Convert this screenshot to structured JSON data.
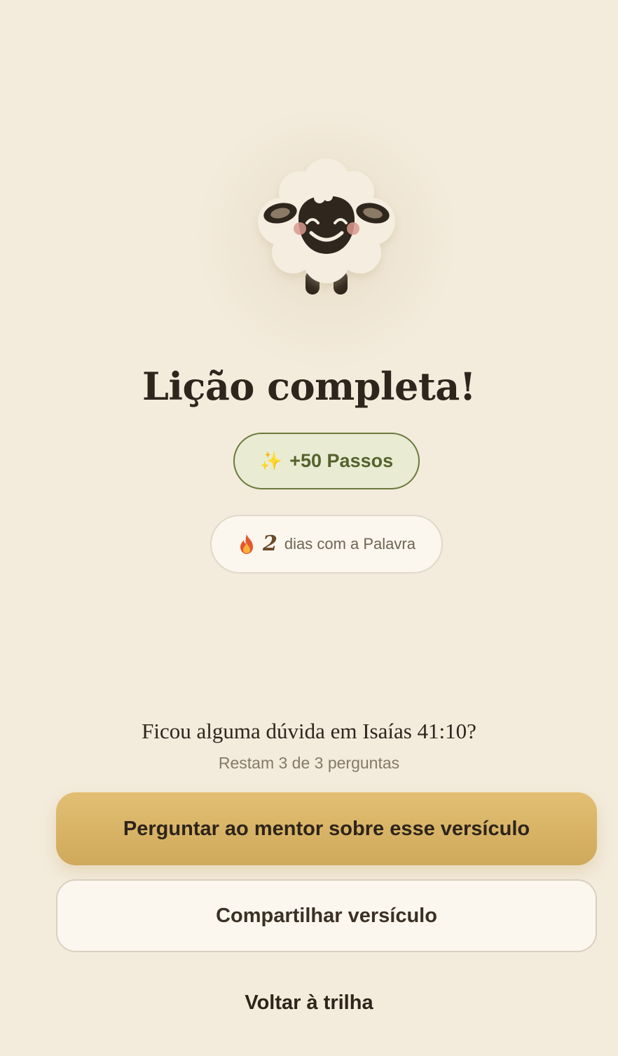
{
  "result": {
    "title": "Lição completa!",
    "mascot": "sheep-mascot"
  },
  "reward": {
    "icon": "sparkles-icon",
    "text": "+50 Passos",
    "color": "#55622c",
    "background": "#e9ecd3"
  },
  "streak": {
    "icon": "flame-icon",
    "count": "2",
    "text": "dias com a Palavra"
  },
  "mentor": {
    "question": "Ficou alguma dúvida em Isaías 41:10?",
    "remaining": "Restam 3 de 3 perguntas"
  },
  "actions": {
    "ask_mentor_label": "Perguntar ao mentor sobre esse versículo",
    "share_label": "Compartilhar versículo",
    "back_label": "Voltar à trilha"
  },
  "colors": {
    "background": "#f3ebdc",
    "accent": "#d8b468",
    "text": "#2e261c"
  }
}
